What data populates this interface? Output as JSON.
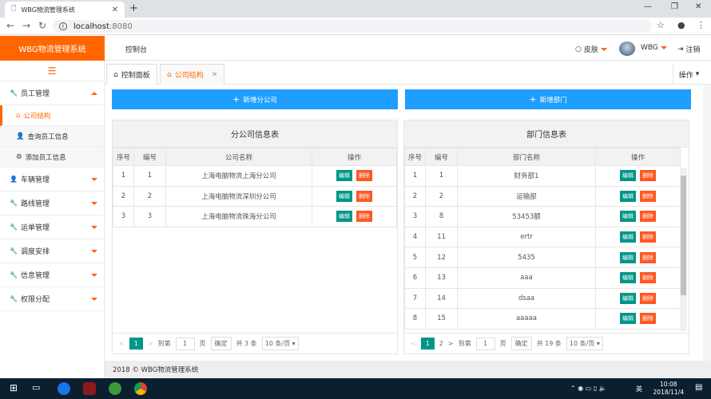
{
  "browser": {
    "tab_title": "WBG物流管理系统",
    "url_host": "localhost",
    "url_port": ":8080"
  },
  "header": {
    "brand": "WBG物流管理系统",
    "console": "控制台",
    "skin": "皮肤",
    "user": "WBG",
    "logout": "注销"
  },
  "sidebar": {
    "groups": [
      {
        "label": "员工管理",
        "icon": "wrench-icon"
      },
      {
        "label": "车辆管理",
        "icon": "user-icon"
      },
      {
        "label": "路线管理",
        "icon": "wrench-icon"
      },
      {
        "label": "运单管理",
        "icon": "wrench-icon"
      },
      {
        "label": "调度安排",
        "icon": "wrench-icon"
      },
      {
        "label": "信息管理",
        "icon": "wrench-icon"
      },
      {
        "label": "权限分配",
        "icon": "wrench-icon"
      }
    ],
    "sub_items": [
      {
        "label": "公司结构",
        "icon": "org-icon"
      },
      {
        "label": "查询员工信息",
        "icon": "user-icon"
      },
      {
        "label": "添加员工信息",
        "icon": "gear-icon"
      }
    ]
  },
  "tabs": {
    "console": "控制面板",
    "company": "公司结构",
    "ops": "操作"
  },
  "buttons": {
    "add_branch": "新增分公司",
    "add_dept": "新增部门"
  },
  "branch_table": {
    "title": "分公司信息表",
    "columns": [
      "序号",
      "编号",
      "公司名称",
      "操作"
    ],
    "rows": [
      [
        "1",
        "1",
        "上海电脑物流上海分公司"
      ],
      [
        "2",
        "2",
        "上海电脑物流深圳分公司"
      ],
      [
        "3",
        "3",
        "上海电脑物流珠海分公司"
      ]
    ],
    "pager": {
      "prev": "<",
      "current": "1",
      "next": ">",
      "goto": "到第",
      "page_input": "1",
      "page_unit": "页",
      "confirm": "确定",
      "total": "共 3 条",
      "per_page": "10 条/页"
    }
  },
  "dept_table": {
    "title": "部门信息表",
    "columns": [
      "序号",
      "编号",
      "部门名称",
      "操作"
    ],
    "rows": [
      [
        "1",
        "1",
        "财务部1"
      ],
      [
        "2",
        "2",
        "运输部"
      ],
      [
        "3",
        "8",
        "53453额"
      ],
      [
        "4",
        "11",
        "ertr"
      ],
      [
        "5",
        "12",
        "5435"
      ],
      [
        "6",
        "13",
        "aaa"
      ],
      [
        "7",
        "14",
        "dsaa"
      ],
      [
        "8",
        "15",
        "aaaaa"
      ]
    ],
    "pager": {
      "prev": "<",
      "current": "1",
      "page2": "2",
      "next": ">",
      "goto": "到第",
      "page_input": "1",
      "page_unit": "页",
      "confirm": "确定",
      "total": "共 19 条",
      "per_page": "10 条/页"
    }
  },
  "actions": {
    "edit": "编辑",
    "delete": "删除"
  },
  "footer": "2018 © WBG物流管理系统",
  "taskbar": {
    "time": "10:08",
    "date": "2018/11/4",
    "ime": "英"
  },
  "colors": {
    "brand": "#ff6600",
    "primary": "#1e9fff",
    "edit": "#009688",
    "delete": "#ff5722"
  }
}
